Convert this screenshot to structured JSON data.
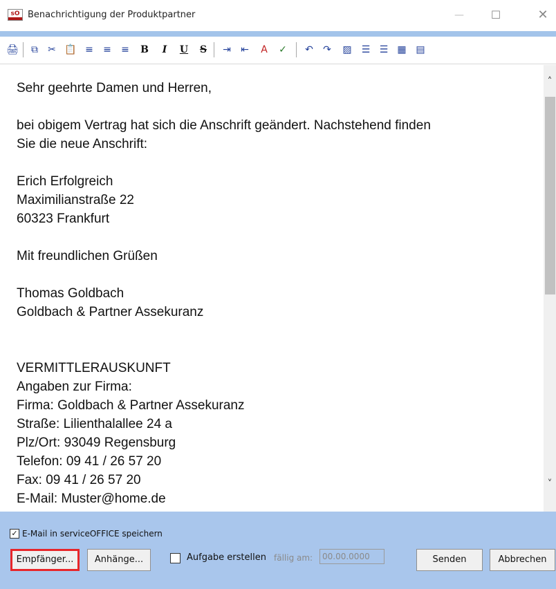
{
  "window": {
    "title": "Benachrichtigung der Produktpartner",
    "app_icon_text": "sO",
    "accent_color": "#a3c4ea"
  },
  "toolbar": {
    "items": [
      {
        "name": "print-icon",
        "glyph": "🖨"
      },
      {
        "name": "copy-icon",
        "glyph": "⧉"
      },
      {
        "name": "cut-icon",
        "glyph": "✂"
      },
      {
        "name": "paste-icon",
        "glyph": "📋"
      },
      {
        "name": "align-left-icon",
        "glyph": "≡"
      },
      {
        "name": "align-center-icon",
        "glyph": "≡"
      },
      {
        "name": "align-right-icon",
        "glyph": "≡"
      },
      {
        "name": "bold-icon",
        "glyph": "B"
      },
      {
        "name": "italic-icon",
        "glyph": "I"
      },
      {
        "name": "underline-icon",
        "glyph": "U"
      },
      {
        "name": "strikethrough-icon",
        "glyph": "S"
      },
      {
        "name": "indent-icon",
        "glyph": "⇥"
      },
      {
        "name": "outdent-icon",
        "glyph": "⇤"
      },
      {
        "name": "font-color-icon",
        "glyph": "A"
      },
      {
        "name": "spellcheck-icon",
        "glyph": "✓"
      },
      {
        "name": "undo-icon",
        "glyph": "↶"
      },
      {
        "name": "redo-icon",
        "glyph": "↷"
      },
      {
        "name": "insert-image-icon",
        "glyph": "▨"
      },
      {
        "name": "numbered-list-icon",
        "glyph": "☰"
      },
      {
        "name": "bullet-list-icon",
        "glyph": "☰"
      },
      {
        "name": "table-icon",
        "glyph": "▦"
      },
      {
        "name": "horizontal-rule-icon",
        "glyph": "▤"
      }
    ]
  },
  "editor": {
    "lines": [
      "Sehr geehrte Damen und Herren,",
      "",
      "bei obigem Vertrag hat sich die Anschrift geändert. Nachstehend finden",
      "Sie die neue Anschrift:",
      "",
      "Erich Erfolgreich",
      "Maximilianstraße 22",
      "60323 Frankfurt",
      "",
      "Mit freundlichen Grüßen",
      "",
      "Thomas Goldbach",
      "Goldbach & Partner Assekuranz",
      "",
      "",
      "VERMITTLERAUSKUNFT",
      "Angaben zur Firma:",
      "Firma: Goldbach & Partner Assekuranz",
      "Straße: Lilienthalallee 24 a",
      "Plz/Ort: 93049 Regensburg",
      "Telefon: 09 41 / 26 57 20",
      "Fax: 09 41 / 26 57 20",
      "E-Mail: Muster@home.de"
    ]
  },
  "bottom": {
    "save_email_label": "E-Mail in serviceOFFICE speichern",
    "save_email_checked": true,
    "recipients_label": "Empfänger...",
    "attachments_label": "Anhänge...",
    "create_task_label": "Aufgabe erstellen",
    "create_task_checked": false,
    "due_label": "fällig am:",
    "due_value": "00.00.0000",
    "send_label": "Senden",
    "cancel_label": "Abbrechen",
    "panel_color": "#a9c6ec",
    "highlight_color": "#e8262a"
  }
}
